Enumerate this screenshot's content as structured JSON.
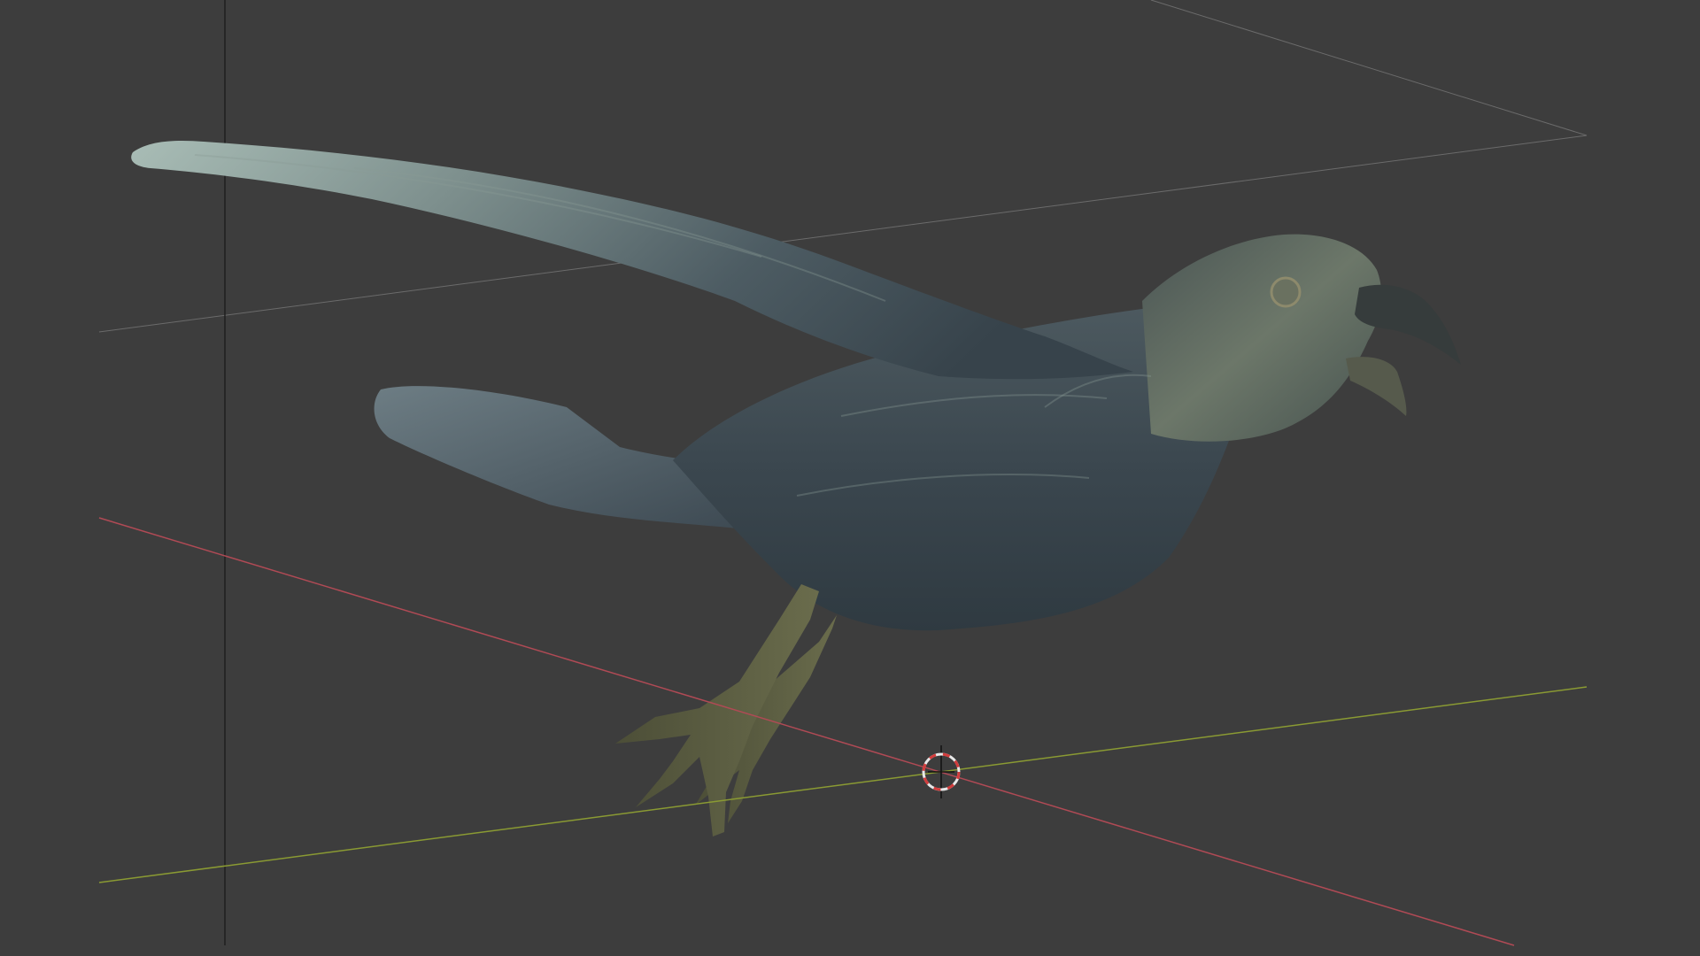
{
  "viewport": {
    "background": "#3d3d3d",
    "view": "perspective",
    "grid_visible": true
  },
  "axes": {
    "x_axis_color": "#b04a55",
    "y_axis_color": "#8a9a33",
    "floor_grid_color": "#6b6b6b",
    "frame_line_color": "#1f1f1f"
  },
  "object": {
    "icon": "crow-mesh",
    "body_color": "#3e4a52",
    "feather_highlight": "#8a9a94",
    "leg_color": "#59593f",
    "beak_color": "#3a3f3e"
  },
  "cursor_3d": {
    "icon": "3d-cursor-icon",
    "ring_color": "#e8e8e8",
    "dash_color": "#d23c3c"
  }
}
